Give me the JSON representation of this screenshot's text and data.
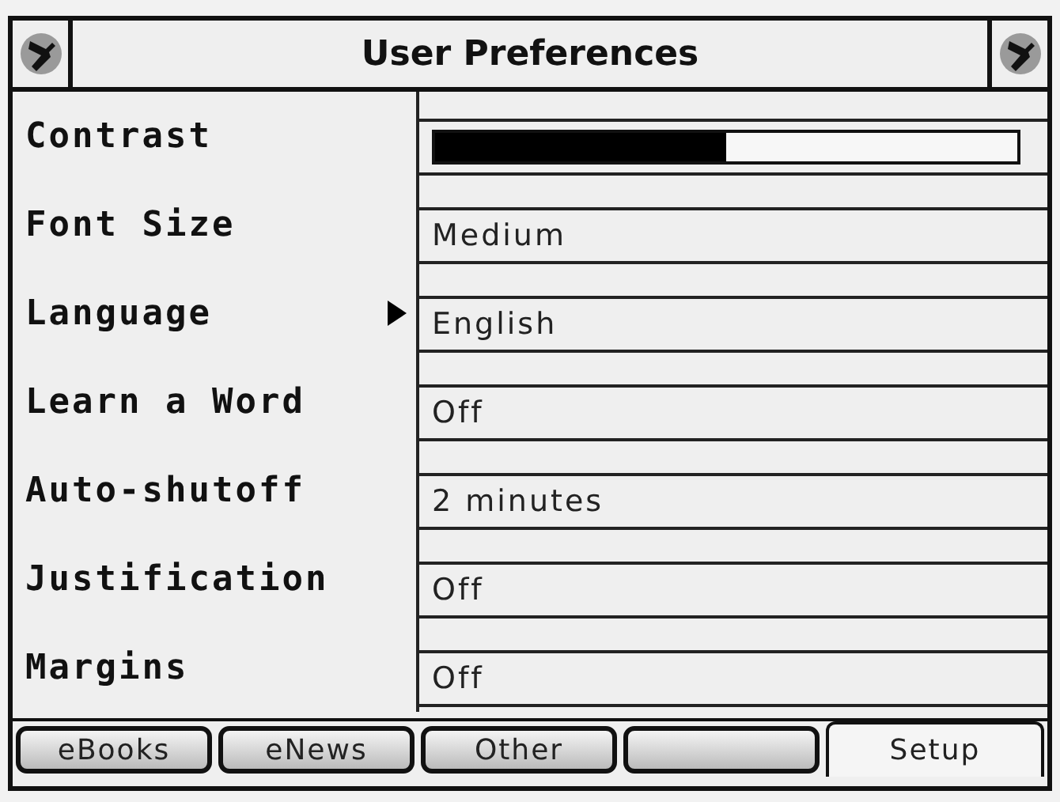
{
  "title": "User Preferences",
  "settings": [
    {
      "label": "Contrast",
      "kind": "slider",
      "level": 0.5,
      "selected": false
    },
    {
      "label": "Font Size",
      "kind": "text",
      "value": "Medium",
      "selected": false
    },
    {
      "label": "Language",
      "kind": "text",
      "value": "English",
      "selected": true
    },
    {
      "label": "Learn a Word",
      "kind": "text",
      "value": "Off",
      "selected": false
    },
    {
      "label": "Auto-shutoff",
      "kind": "text",
      "value": "2 minutes",
      "selected": false
    },
    {
      "label": "Justification",
      "kind": "text",
      "value": "Off",
      "selected": false
    },
    {
      "label": "Margins",
      "kind": "text",
      "value": "Off",
      "selected": false
    }
  ],
  "tabs": [
    {
      "label": "eBooks",
      "selected": false
    },
    {
      "label": "eNews",
      "selected": false
    },
    {
      "label": "Other",
      "selected": false
    },
    {
      "selected": false
    },
    {
      "label": "Setup",
      "selected": true
    }
  ]
}
